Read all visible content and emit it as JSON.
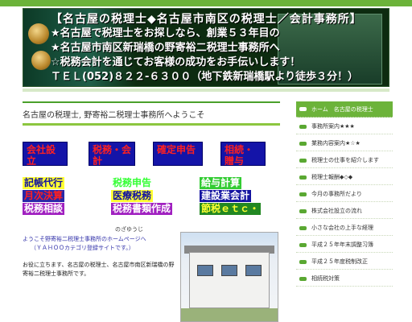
{
  "header": {
    "lines": [
      "【名古屋の税理士◆名古屋市南区の税理士／会計事務所】",
      "★名古屋で税理士をお探しなら、創業５３年目の",
      "★名古屋市南区新瑞橋の野寄裕二税理士事務所へ",
      "☆税務会計を通じてお客様の成功をお手伝いします！",
      "ＴＥＬ(052)８２２-６３００（地下鉄新瑞橋駅より徒歩３分！）"
    ]
  },
  "main": {
    "welcome": "名古屋の税理士, 野寄裕二税理士事務所へようこそ",
    "buttons": [
      "会社設立",
      "税務・会計",
      "確定申告",
      "相続・贈与"
    ],
    "tags": [
      {
        "label": "記帳代行",
        "color": "#1010a0",
        "bg": "#ffff33"
      },
      {
        "label": "税務申告",
        "color": "#33ff33",
        "bg": "#ffffff"
      },
      {
        "label": "給与計算",
        "color": "#ffffff",
        "bg": "#33cc33"
      },
      {
        "label": "月次決算",
        "color": "#ff2020",
        "bg": "#2828a8"
      },
      {
        "label": "医療税務",
        "color": "#1010a0",
        "bg": "#ffff33"
      },
      {
        "label": "建設業会計",
        "color": "#ffffff",
        "bg": "#1414a0"
      },
      {
        "label": "税務相談",
        "color": "#ffffff",
        "bg": "#a020c0"
      },
      {
        "label": "税務書類作成",
        "color": "#ffffff",
        "bg": "#a020c0"
      },
      {
        "label": "節税ｅｔｃ・",
        "color": "#ffff33",
        "bg": "#228822"
      }
    ],
    "intro": {
      "subname": "のざゆうじ",
      "line1": "ようこそ野寄裕二税理士事務所のホームページへ",
      "line2": "（ＹＡＨＯＯカテゴリ登録サイトです。）",
      "para": "お役に立ちます、名古屋の税理士、名古屋市南区新瑞橋の野寄裕二税理士事務所です。"
    }
  },
  "sidebar": {
    "items": [
      "ホーム　名古屋の税理士",
      "事務所案内★★★",
      "業務内容案内★☆★",
      "税理士の仕事を紹介します",
      "税理士報酬◆◇◆",
      "今月の事務所だより",
      "株式会社設立の流れ",
      "小さな会社の上手な経理",
      "平成２５年年末調整习簿",
      "平成２５年度税制改正",
      "相続税対策"
    ]
  },
  "colors": {
    "accent": "#6cb33a",
    "header_bg": "#0d2b10",
    "button_bg": "#1414a8",
    "button_text": "#ff2020"
  }
}
